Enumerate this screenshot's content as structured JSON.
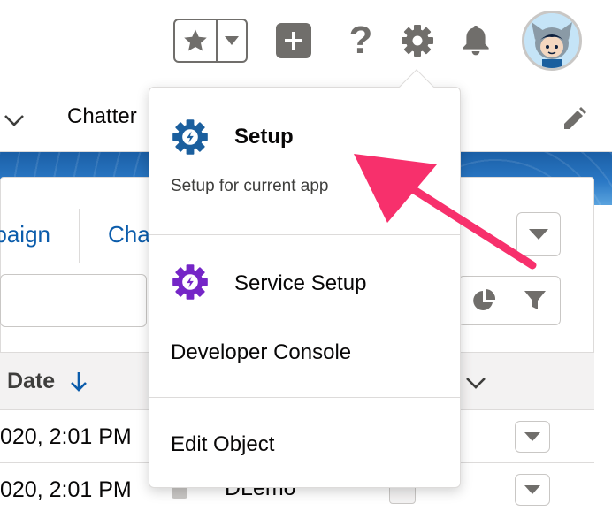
{
  "header": {
    "favorites_icon": "star-icon",
    "favorites_menu_icon": "caret-down-icon",
    "add_icon": "plus-icon",
    "help_icon": "question-icon",
    "help_glyph": "?",
    "setup_icon": "gear-icon",
    "notifications_icon": "bell-icon",
    "avatar_icon": "astro-avatar"
  },
  "nav": {
    "app_menu_icon": "chevron-down-icon",
    "item_label": "Chatter",
    "edit_icon": "pencil-icon"
  },
  "list": {
    "tab_campaign_label": "paign",
    "tab_chat_label": "Cha",
    "column_date_label": "Date",
    "rows": [
      {
        "date": "020, 2:01 PM",
        "name": ""
      },
      {
        "date": "020, 2:01 PM",
        "name": "DLemo"
      }
    ]
  },
  "setup_menu": {
    "setup_label": "Setup",
    "setup_sub": "Setup for current app",
    "service_setup_label": "Service Setup",
    "developer_console_label": "Developer Console",
    "edit_object_label": "Edit Object"
  },
  "colors": {
    "setup_gear": "#1b5f9e",
    "service_gear": "#7526c7",
    "annotation_arrow": "#f7306c",
    "link_blue": "#0b5cab"
  }
}
